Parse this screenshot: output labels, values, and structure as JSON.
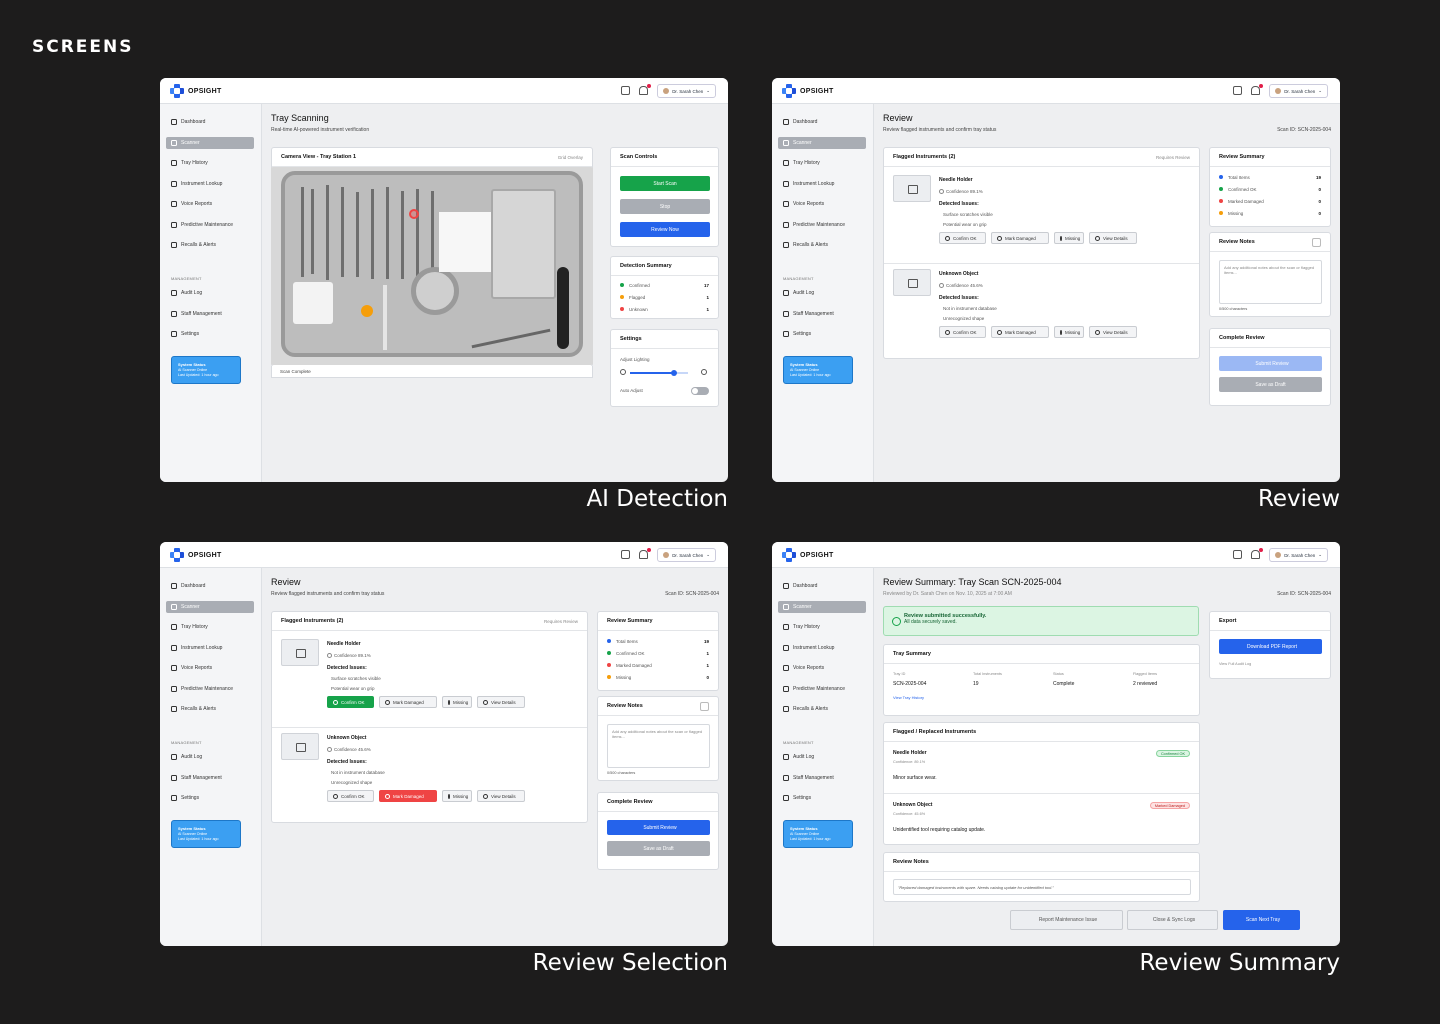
{
  "page_heading": "SCREENS",
  "common": {
    "logo": "OPSIGHT",
    "user": "Dr. Sarah Chen",
    "nav": [
      "Dashboard",
      "Scanner",
      "Tray History",
      "Instrument Lookup",
      "Voice Reports",
      "Predictive Maintenance",
      "Recalls & Alerts"
    ],
    "management_label": "MANAGEMENT",
    "mgmt_nav": [
      "Audit Log",
      "Staff Management",
      "Settings"
    ],
    "status_title": "System Status",
    "status_line1": "AI Scanner Online",
    "status_line2": "Last Updated: 1 hour ago"
  },
  "captions": [
    "AI Detection",
    "Review",
    "Review Selection",
    "Review Summary"
  ],
  "detection": {
    "title": "Tray Scanning",
    "subtitle": "Real-time AI-powered instrument verification",
    "camera_label": "Camera View - Tray Station 1",
    "grid_overlay": "Grid Overlay",
    "footer": "Scan Complete",
    "controls_title": "Scan Controls",
    "start": "Start Scan",
    "stop": "Stop",
    "review": "Review Now",
    "summary_title": "Detection Summary",
    "summary": [
      {
        "label": "Confirmed",
        "value": "17",
        "color": "#16a34a"
      },
      {
        "label": "Flagged",
        "value": "1",
        "color": "#f59e0b"
      },
      {
        "label": "Unknown",
        "value": "1",
        "color": "#ef4444"
      }
    ],
    "settings_title": "Settings",
    "adjust_lighting": "Adjust Lighting",
    "auto_adjust": "Auto Adjust",
    "lighting_level": 0.75
  },
  "review": {
    "title": "Review",
    "subtitle": "Review flagged instruments and confirm tray status",
    "scan_id": "Scan ID: SCN-2025-004",
    "flagged_title": "Flagged Instruments (2)",
    "requires_review": "Requires Review",
    "detected_issues": "Detected Issues:",
    "items": [
      {
        "name": "Needle Holder",
        "confidence": "Confidence 89.1%",
        "issues": [
          "Surface scratches visible",
          "Potential wear on grip"
        ]
      },
      {
        "name": "Unknown Object",
        "confidence": "Confidence 45.6%",
        "issues": [
          "Not in instrument database",
          "Unrecognized shape"
        ]
      }
    ],
    "actions": [
      "Confirm OK",
      "Mark Damaged",
      "Missing",
      "View Details"
    ],
    "summary_title": "Review Summary",
    "summary_a": [
      {
        "label": "Total Items",
        "value": "19",
        "color": "#2563eb"
      },
      {
        "label": "Confirmed OK",
        "value": "0",
        "color": "#16a34a"
      },
      {
        "label": "Marked Damaged",
        "value": "0",
        "color": "#ef4444"
      },
      {
        "label": "Missing",
        "value": "0",
        "color": "#f59e0b"
      }
    ],
    "summary_b": [
      {
        "label": "Total Items",
        "value": "19",
        "color": "#2563eb"
      },
      {
        "label": "Confirmed OK",
        "value": "1",
        "color": "#16a34a"
      },
      {
        "label": "Marked Damaged",
        "value": "1",
        "color": "#ef4444"
      },
      {
        "label": "Missing",
        "value": "0",
        "color": "#f59e0b"
      }
    ],
    "notes_title": "Review Notes",
    "notes_placeholder": "Add any additional notes about the scan or flagged items...",
    "char_count": "0/500 characters",
    "complete_title": "Complete Review",
    "submit": "Submit Review",
    "draft": "Save as Draft"
  },
  "summary": {
    "title": "Review Summary: Tray Scan SCN-2025-004",
    "subtitle": "Reviewed by Dr. Sarah Chen on Nov. 10, 2025 at 7:00 AM",
    "scan_id": "Scan ID: SCN-2025-004",
    "success_title": "Review submitted successfully.",
    "success_sub": "All data securely saved.",
    "tray_title": "Tray Summary",
    "tray_fields": [
      {
        "k": "Tray ID",
        "v": "SCN-2025-004"
      },
      {
        "k": "Total Instruments",
        "v": "19"
      },
      {
        "k": "Status",
        "v": "Complete"
      },
      {
        "k": "Flagged Items",
        "v": "2 reviewed"
      }
    ],
    "view_history": "View Tray History",
    "flagged_title": "Flagged / Replaced Instruments",
    "items": [
      {
        "name": "Needle Holder",
        "conf": "Confidence: 89.1%",
        "note": "Minor surface wear.",
        "badge": "Confirmed OK"
      },
      {
        "name": "Unknown Object",
        "conf": "Confidence: 45.6%",
        "note": "Unidentified tool requiring catalog update.",
        "badge": "Marked Damaged"
      }
    ],
    "notes_title": "Review Notes",
    "notes_text": "\"Replaced damaged instruments with spare. Needs catalog update for unidentified tool.\"",
    "report": "Report Maintenance Issue",
    "close": "Close & Sync Logs",
    "next": "Scan Next Tray",
    "export_title": "Export",
    "download": "Download PDF Report",
    "audit": "View Full Audit Log"
  }
}
